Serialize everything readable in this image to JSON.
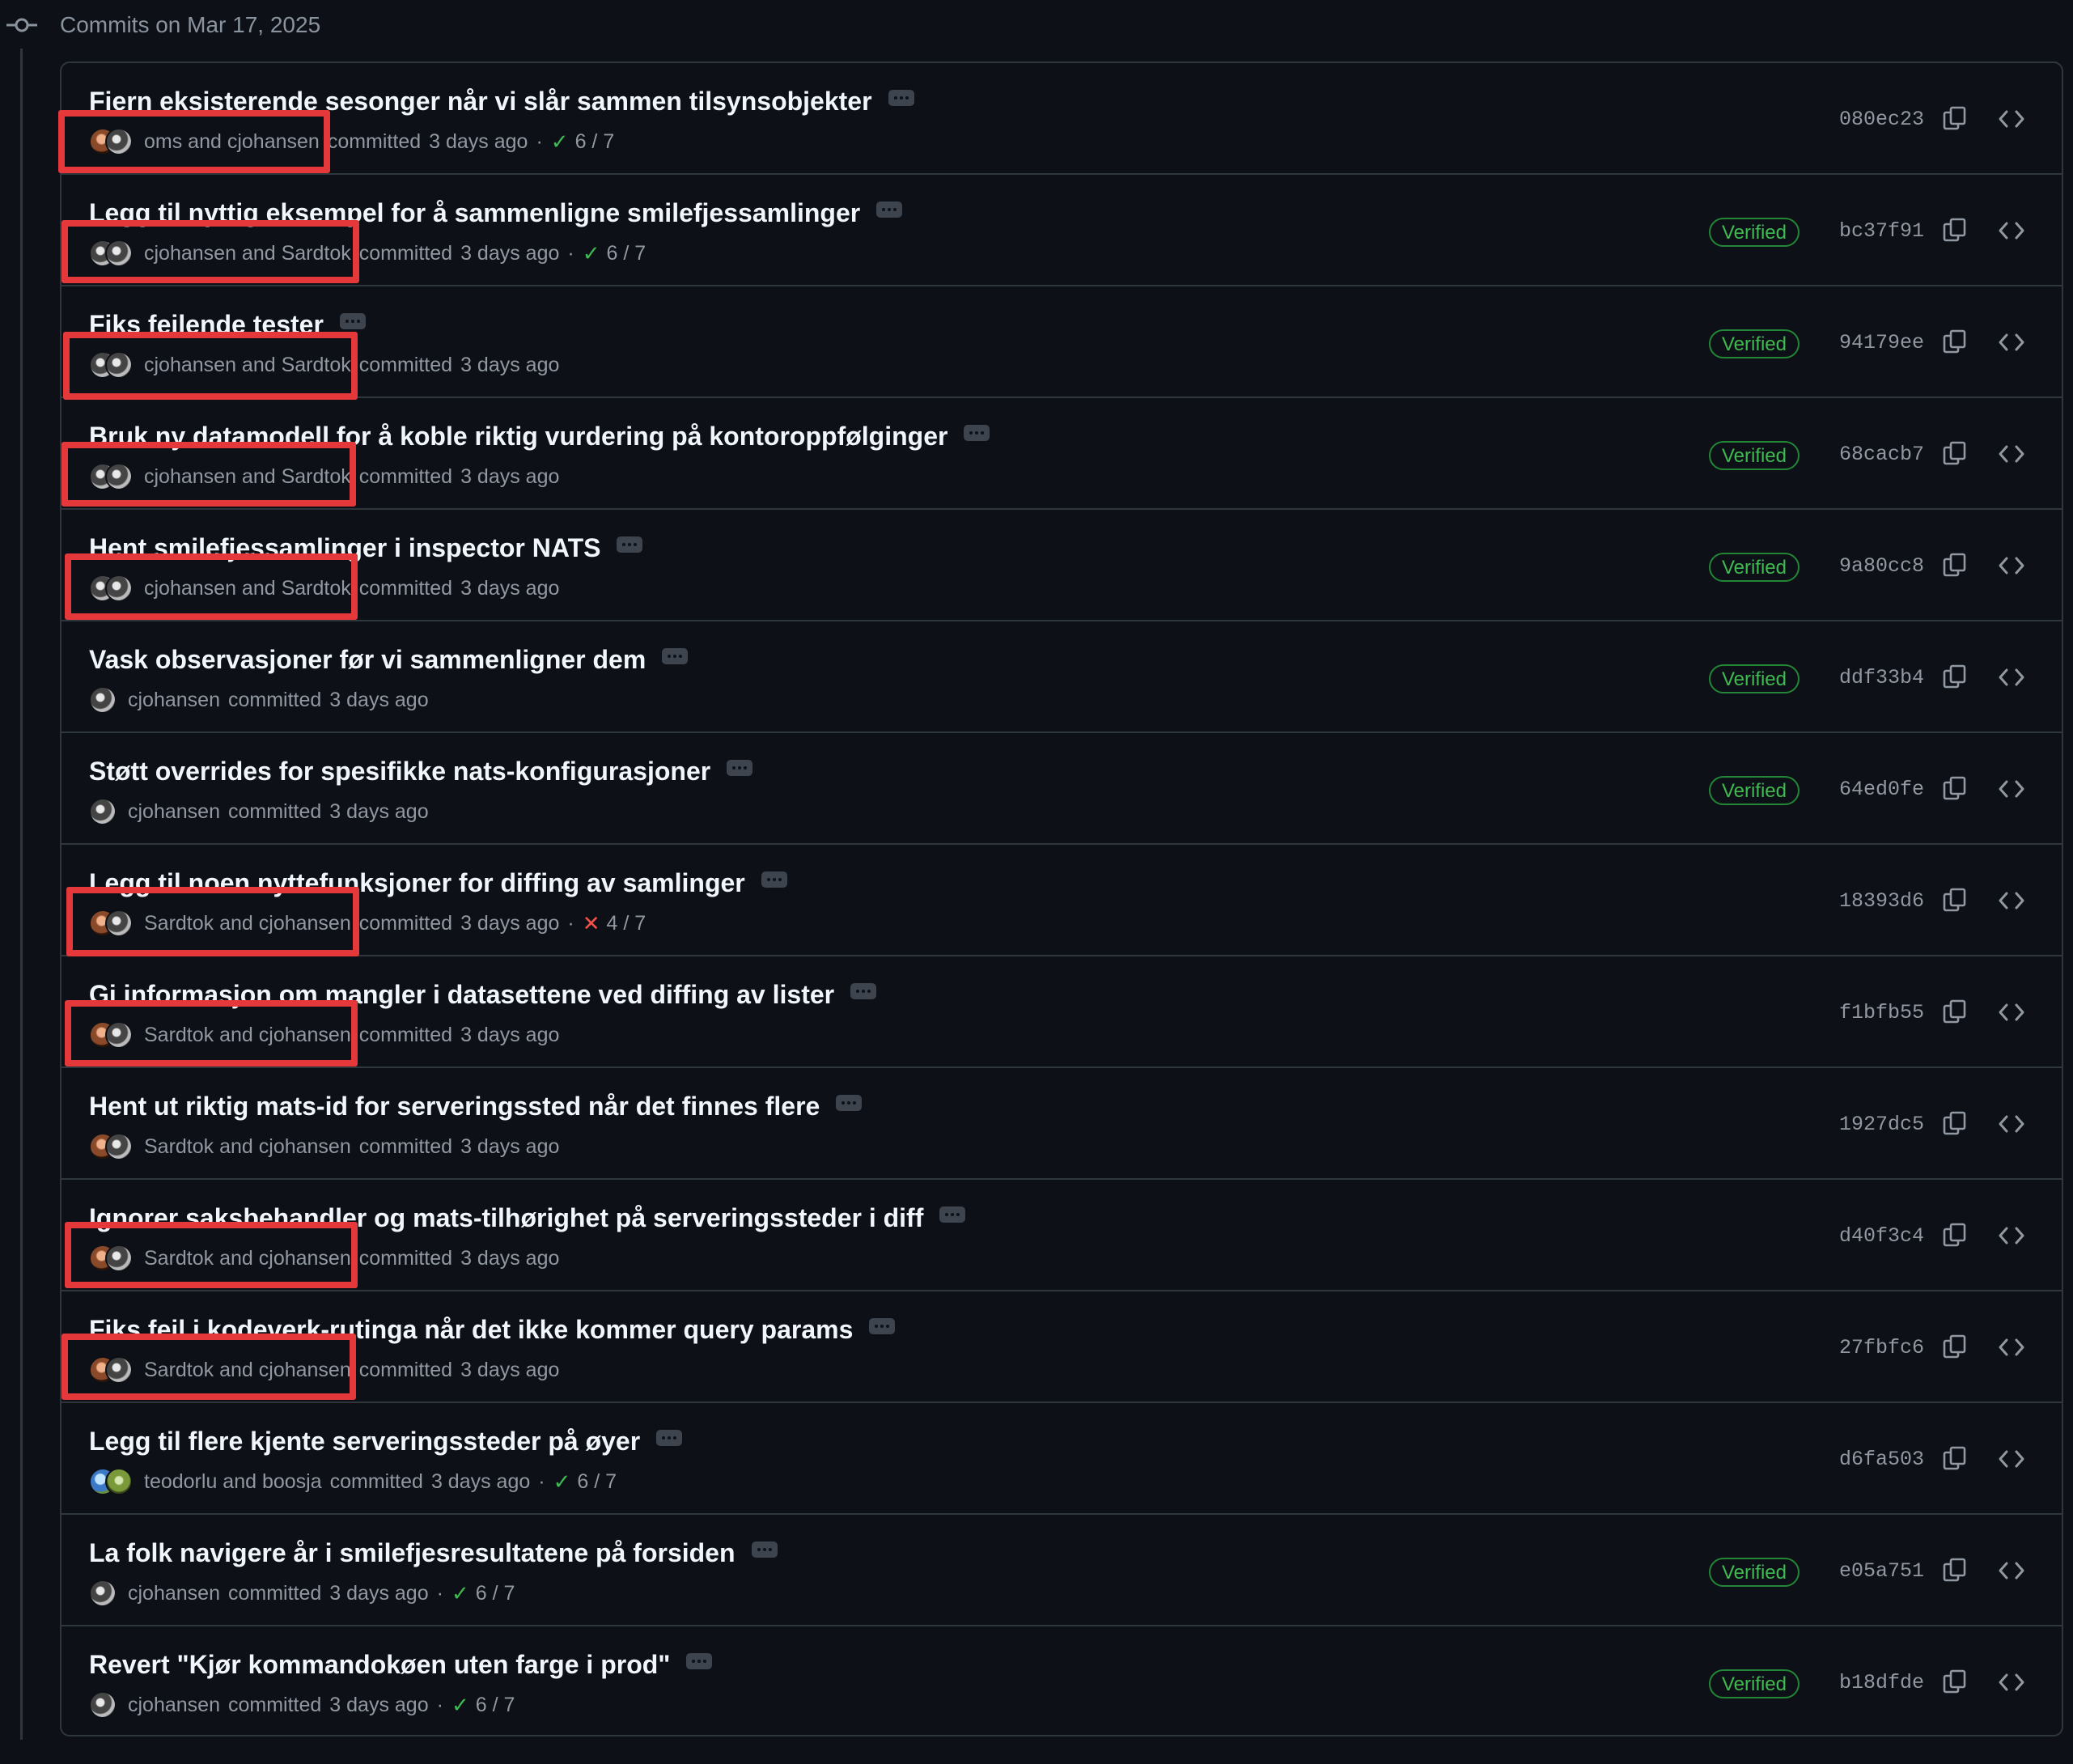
{
  "header": {
    "title": "Commits on Mar 17, 2025"
  },
  "commits": [
    {
      "title": "Fjern eksisterende sesonger når vi slår sammen tilsynsobjekter",
      "authors": "oms and cjohansen",
      "verb": "committed",
      "time": "3 days ago",
      "checks": "6 / 7",
      "status": "success",
      "verified": "",
      "sha": "080ec23"
    },
    {
      "title": "Legg til nyttig eksempel for å sammenligne smilefjessamlinger",
      "authors": "cjohansen and Sardtok",
      "verb": "committed",
      "time": "3 days ago",
      "checks": "6 / 7",
      "status": "success",
      "verified": "Verified",
      "sha": "bc37f91"
    },
    {
      "title": "Fiks feilende tester",
      "authors": "cjohansen and Sardtok",
      "verb": "committed",
      "time": "3 days ago",
      "checks": "",
      "status": "",
      "verified": "Verified",
      "sha": "94179ee"
    },
    {
      "title": "Bruk ny datamodell for å koble riktig vurdering på kontoroppfølginger",
      "authors": "cjohansen and Sardtok",
      "verb": "committed",
      "time": "3 days ago",
      "checks": "",
      "status": "",
      "verified": "Verified",
      "sha": "68cacb7"
    },
    {
      "title": "Hent smilefjessamlinger i inspector NATS",
      "authors": "cjohansen and Sardtok",
      "verb": "committed",
      "time": "3 days ago",
      "checks": "",
      "status": "",
      "verified": "Verified",
      "sha": "9a80cc8"
    },
    {
      "title": "Vask observasjoner før vi sammenligner dem",
      "authors": "cjohansen",
      "verb": "committed",
      "time": "3 days ago",
      "checks": "",
      "status": "",
      "verified": "Verified",
      "sha": "ddf33b4"
    },
    {
      "title": "Støtt overrides for spesifikke nats-konfigurasjoner",
      "authors": "cjohansen",
      "verb": "committed",
      "time": "3 days ago",
      "checks": "",
      "status": "",
      "verified": "Verified",
      "sha": "64ed0fe"
    },
    {
      "title": "Legg til noen nyttefunksjoner for diffing av samlinger",
      "authors": "Sardtok and cjohansen",
      "verb": "committed",
      "time": "3 days ago",
      "checks": "4 / 7",
      "status": "failure",
      "verified": "",
      "sha": "18393d6"
    },
    {
      "title": "Gi informasjon om mangler i datasettene ved diffing av lister",
      "authors": "Sardtok and cjohansen",
      "verb": "committed",
      "time": "3 days ago",
      "checks": "",
      "status": "",
      "verified": "",
      "sha": "f1bfb55"
    },
    {
      "title": "Hent ut riktig mats-id for serveringssted når det finnes flere",
      "authors": "Sardtok and cjohansen",
      "verb": "committed",
      "time": "3 days ago",
      "checks": "",
      "status": "",
      "verified": "",
      "sha": "1927dc5"
    },
    {
      "title": "Ignorer saksbehandler og mats-tilhørighet på serveringssteder i diff",
      "authors": "Sardtok and cjohansen",
      "verb": "committed",
      "time": "3 days ago",
      "checks": "",
      "status": "",
      "verified": "",
      "sha": "d40f3c4"
    },
    {
      "title": "Fiks feil i kodeverk-rutinga når det ikke kommer query params",
      "authors": "Sardtok and cjohansen",
      "verb": "committed",
      "time": "3 days ago",
      "checks": "",
      "status": "",
      "verified": "",
      "sha": "27fbfc6"
    },
    {
      "title": "Legg til flere kjente serveringssteder på øyer",
      "authors": "teodorlu and boosja",
      "verb": "committed",
      "time": "3 days ago",
      "checks": "6 / 7",
      "status": "success",
      "verified": "",
      "sha": "d6fa503"
    },
    {
      "title": "La folk navigere år i smilefjesresultatene på forsiden",
      "authors": "cjohansen",
      "verb": "committed",
      "time": "3 days ago",
      "checks": "6 / 7",
      "status": "success",
      "verified": "Verified",
      "sha": "e05a751"
    },
    {
      "title": "Revert \"Kjør kommandokøen uten farge i prod\"",
      "authors": "cjohansen",
      "verb": "committed",
      "time": "3 days ago",
      "checks": "6 / 7",
      "status": "success",
      "verified": "Verified",
      "sha": "b18dfde"
    }
  ],
  "colors": {
    "background": "#0d1117",
    "border": "#30363d",
    "verified": "#3fb950",
    "failure": "#f85149",
    "highlight": "#e5383b"
  }
}
